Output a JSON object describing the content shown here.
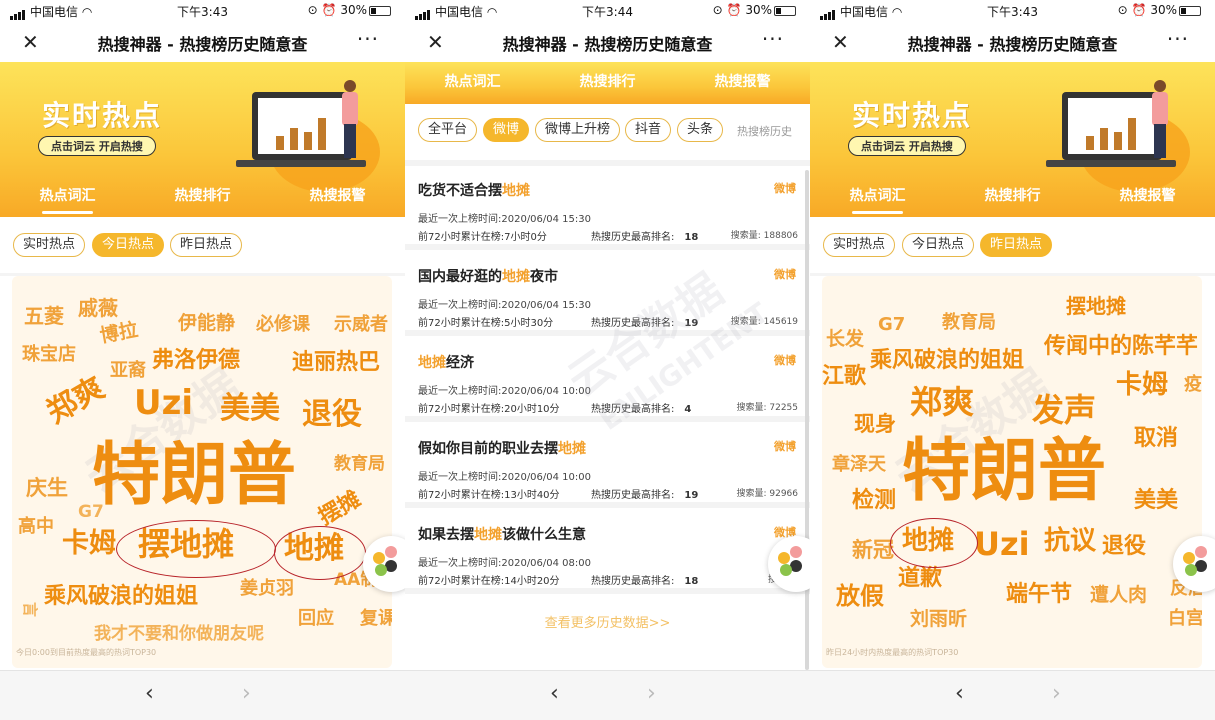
{
  "status": {
    "p1": {
      "carrier": "中国电信",
      "time": "下午3:43",
      "battery": "30%"
    },
    "p2": {
      "carrier": "中国电信",
      "time": "下午3:44",
      "battery": "30%"
    },
    "p3": {
      "carrier": "中国电信",
      "time": "下午3:43",
      "battery": "30%"
    }
  },
  "nav": {
    "title": "热搜神器 - 热搜榜历史随意查",
    "close": "✕",
    "more": "···"
  },
  "banner": {
    "title": "实时热点",
    "pill": "点击词云 开启热搜"
  },
  "tabs": [
    "热点词汇",
    "热搜排行",
    "热搜报警"
  ],
  "cloud_filters": [
    "实时热点",
    "今日热点",
    "昨日热点"
  ],
  "platform_filters": [
    "全平台",
    "微博",
    "微博上升榜",
    "抖音",
    "头条"
  ],
  "history_link": "热搜榜历史",
  "watermark": "云合数据",
  "watermark_en": "ENLIGHTENT",
  "colors": {
    "accent": "#f5b72c",
    "word_high": "#ee8d10",
    "circle": "#b8242a"
  },
  "cloud1": {
    "caption": "今日0:00到目前热度最高的热词TOP30",
    "words": [
      "五菱",
      "戚薇",
      "博拉",
      "伊能静",
      "必修课",
      "示威者",
      "珠宝店",
      "亚裔",
      "弗洛伊德",
      "迪丽热巴",
      "郑爽",
      "Uzi",
      "美美",
      "退役",
      "教育局",
      "特朗普",
      "庆生",
      "G7",
      "摆摊",
      "高中",
      "卡姆",
      "摆地摊",
      "地摊",
      "姜贞羽",
      "AA制",
      "乘风破浪的姐姐",
      "回应",
      "复课",
      "我才不要和你做朋友呢",
      "言"
    ]
  },
  "cloud2": {
    "caption": "昨日24小时内热度最高的热词TOP30",
    "words": [
      "摆地摊",
      "G7",
      "教育局",
      "长发",
      "乘风破浪的姐姐",
      "传闻中的陈芊芊",
      "江歌",
      "卡姆",
      "疫情",
      "郑爽",
      "发声",
      "现身",
      "取消",
      "章泽天",
      "特朗普",
      "检测",
      "美美",
      "地摊",
      "Uzi",
      "抗议",
      "退役",
      "新冠",
      "道歉",
      "放假",
      "端午节",
      "遭人肉",
      "反盾",
      "刘雨昕",
      "白宫"
    ]
  },
  "list": [
    {
      "pre": "吃货不适合摆",
      "kw": "地摊",
      "post": "",
      "source": "微博",
      "last": "最近一次上榜时间:2020/06/04 15:30",
      "hours": "前72小时累计在榜:7小时0分",
      "rank_label": "热搜历史最高排名:",
      "rank": "18",
      "volume": "搜索量: 188806"
    },
    {
      "pre": "国内最好逛的",
      "kw": "地摊",
      "post": "夜市",
      "source": "微博",
      "last": "最近一次上榜时间:2020/06/04 15:30",
      "hours": "前72小时累计在榜:5小时30分",
      "rank_label": "热搜历史最高排名:",
      "rank": "19",
      "volume": "搜索量: 145619"
    },
    {
      "pre": "",
      "kw": "地摊",
      "post": "经济",
      "source": "微博",
      "last": "最近一次上榜时间:2020/06/04 10:00",
      "hours": "前72小时累计在榜:20小时10分",
      "rank_label": "热搜历史最高排名:",
      "rank": "4",
      "volume": "搜索量: 72255"
    },
    {
      "pre": "假如你目前的职业去摆",
      "kw": "地摊",
      "post": "",
      "source": "微博",
      "last": "最近一次上榜时间:2020/06/04 10:00",
      "hours": "前72小时累计在榜:13小时40分",
      "rank_label": "热搜历史最高排名:",
      "rank": "19",
      "volume": "搜索量: 92966"
    },
    {
      "pre": "如果去摆",
      "kw": "地摊",
      "post": "该做什么生意",
      "source": "微博",
      "last": "最近一次上榜时间:2020/06/04 08:00",
      "hours": "前72小时累计在榜:14小时20分",
      "rank_label": "热搜历史最高排名:",
      "rank": "18",
      "volume": "搜索量:"
    }
  ],
  "more_history": "查看更多历史数据>>",
  "bottom": {
    "back": "‹",
    "forward": "›"
  }
}
